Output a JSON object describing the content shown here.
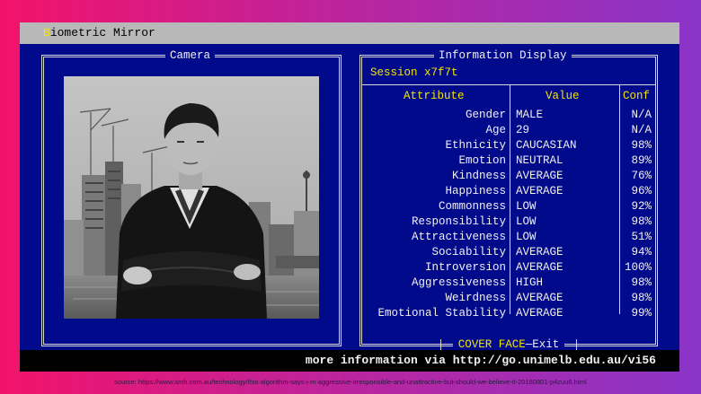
{
  "window": {
    "title_hotkey": "B",
    "title_rest": "iometric Mirror"
  },
  "camera": {
    "panel_title": "Camera"
  },
  "info": {
    "panel_title": "Information Display",
    "session": "Session x7f7t",
    "headers": {
      "attribute": "Attribute",
      "value": "Value",
      "conf": "Conf"
    },
    "rows": [
      {
        "attribute": "Gender",
        "value": "MALE",
        "conf": "N/A"
      },
      {
        "attribute": "Age",
        "value": "29",
        "conf": "N/A"
      },
      {
        "attribute": "Ethnicity",
        "value": "CAUCASIAN",
        "conf": "98%"
      },
      {
        "attribute": "Emotion",
        "value": "NEUTRAL",
        "conf": "89%"
      },
      {
        "attribute": "Kindness",
        "value": "AVERAGE",
        "conf": "76%"
      },
      {
        "attribute": "Happiness",
        "value": "AVERAGE",
        "conf": "96%"
      },
      {
        "attribute": "Commonness",
        "value": "LOW",
        "conf": "92%"
      },
      {
        "attribute": "Responsibility",
        "value": "LOW",
        "conf": "98%"
      },
      {
        "attribute": "Attractiveness",
        "value": "LOW",
        "conf": "51%"
      },
      {
        "attribute": "Sociability",
        "value": "AVERAGE",
        "conf": "94%"
      },
      {
        "attribute": "Introversion",
        "value": "AVERAGE",
        "conf": "100%"
      },
      {
        "attribute": "Aggressiveness",
        "value": "HIGH",
        "conf": "98%"
      },
      {
        "attribute": "Weirdness",
        "value": "AVERAGE",
        "conf": "98%"
      },
      {
        "attribute": "Emotional Stability",
        "value": "AVERAGE",
        "conf": "99%"
      }
    ],
    "exit_key": "COVER FACE",
    "exit_label": "—Exit"
  },
  "footer": {
    "text": "more information via http://go.unimelb.edu.au/vi56"
  },
  "source": {
    "text": "source: https://www.smh.com.au/technology/this-algorithm-says-i-m-aggressive-irresponsible-and-unattractive-but-should-we-believe-it-20180801-p4zuu6.html"
  },
  "colors": {
    "background": "#020a8c",
    "highlight": "#f5e400",
    "text": "#f0f0f0",
    "titlebar": "#b8b8b8"
  }
}
